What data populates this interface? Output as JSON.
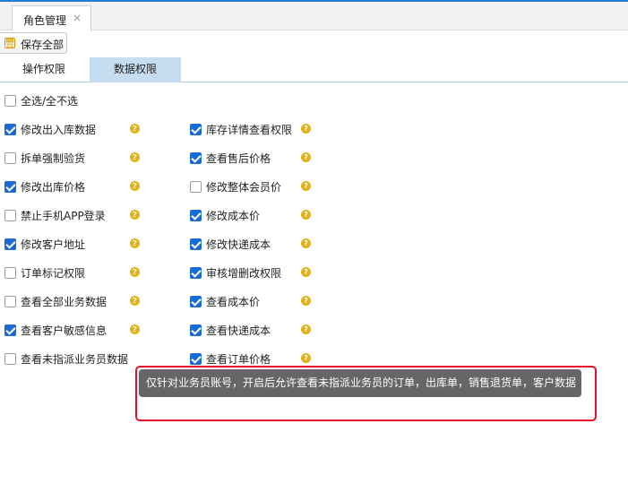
{
  "window": {
    "tab_title": "角色管理",
    "tab_close": "×"
  },
  "toolbar": {
    "save_all_label": "保存全部"
  },
  "subtabs": {
    "operation": "操作权限",
    "data": "数据权限"
  },
  "select_all": {
    "label": "全选/全不选",
    "checked": false
  },
  "permissions_left": [
    {
      "label": "修改出入库数据",
      "checked": true
    },
    {
      "label": "拆单强制验货",
      "checked": false
    },
    {
      "label": "修改出库价格",
      "checked": true
    },
    {
      "label": "禁止手机APP登录",
      "checked": false
    },
    {
      "label": "修改客户地址",
      "checked": true
    },
    {
      "label": "订单标记权限",
      "checked": false
    },
    {
      "label": "查看全部业务数据",
      "checked": false
    },
    {
      "label": "查看客户敏感信息",
      "checked": true
    },
    {
      "label": "查看未指派业务员数据",
      "checked": false
    }
  ],
  "permissions_right": [
    {
      "label": "库存详情查看权限",
      "checked": true
    },
    {
      "label": "查看售后价格",
      "checked": true
    },
    {
      "label": "修改整体会员价",
      "checked": false
    },
    {
      "label": "修改成本价",
      "checked": true
    },
    {
      "label": "修改快递成本",
      "checked": true
    },
    {
      "label": "审核增删改权限",
      "checked": true
    },
    {
      "label": "查看成本价",
      "checked": true
    },
    {
      "label": "查看快递成本",
      "checked": true
    },
    {
      "label": "查看订单价格",
      "checked": true
    }
  ],
  "help_glyph": "?",
  "tooltip": {
    "text": "仅针对业务员账号，开启后允许查看未指派业务员的订单，出库单，销售退货单，客户数据"
  },
  "colors": {
    "accent": "#1a6bd3",
    "active_subtab": "#c6dcf0",
    "help_icon": "#e2b21c",
    "tooltip_bg": "#666666",
    "highlight_border": "#e4102a"
  }
}
